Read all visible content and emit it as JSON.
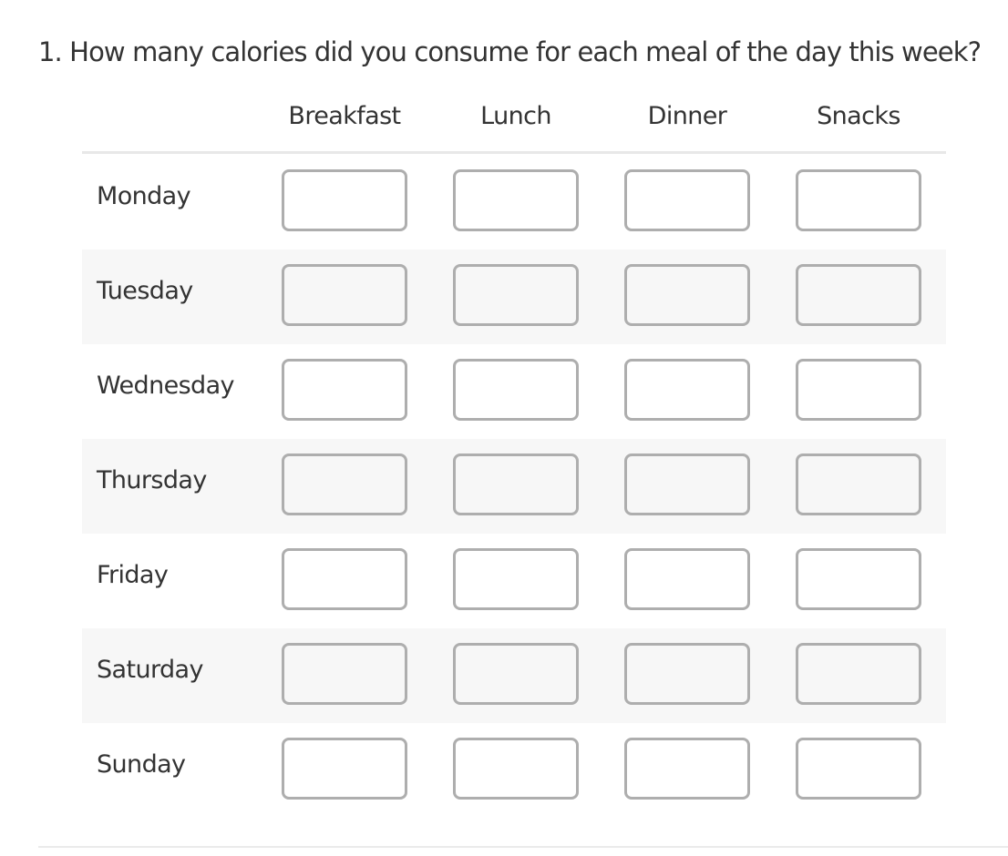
{
  "question": {
    "number": "1.",
    "text": "1. How many calories did you consume for each meal of the day this week?"
  },
  "columns": [
    "Breakfast",
    "Lunch",
    "Dinner",
    "Snacks"
  ],
  "rows": [
    {
      "label": "Monday",
      "values": [
        "",
        "",
        "",
        ""
      ]
    },
    {
      "label": "Tuesday",
      "values": [
        "",
        "",
        "",
        ""
      ]
    },
    {
      "label": "Wednesday",
      "values": [
        "",
        "",
        "",
        ""
      ]
    },
    {
      "label": "Thursday",
      "values": [
        "",
        "",
        "",
        ""
      ]
    },
    {
      "label": "Friday",
      "values": [
        "",
        "",
        "",
        ""
      ]
    },
    {
      "label": "Saturday",
      "values": [
        "",
        "",
        "",
        ""
      ]
    },
    {
      "label": "Sunday",
      "values": [
        "",
        "",
        "",
        ""
      ]
    }
  ],
  "colors": {
    "text": "#333333",
    "input_border": "#aeaeae",
    "alt_row_bg": "#f7f7f7",
    "divider": "#e8e8e8"
  }
}
